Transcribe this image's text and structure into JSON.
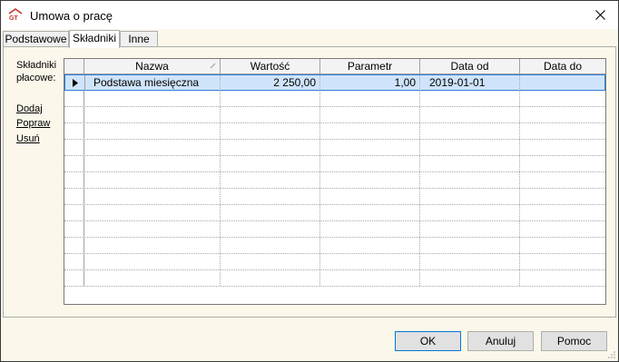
{
  "window": {
    "title": "Umowa o pracę"
  },
  "tabs": [
    {
      "label": "Podstawowe",
      "active": false
    },
    {
      "label": "Składniki",
      "active": true
    },
    {
      "label": "Inne",
      "active": false
    }
  ],
  "sidebar": {
    "label_line1": "Składniki",
    "label_line2": "płacowe:",
    "links": [
      "Dodaj",
      "Popraw",
      "Usuń"
    ]
  },
  "grid": {
    "columns": [
      "Nazwa",
      "Wartość",
      "Parametr",
      "Data od",
      "Data do"
    ],
    "rows": [
      {
        "nazwa": "Podstawa miesięczna",
        "wartosc": "2 250,00",
        "parametr": "1,00",
        "data_od": "2019-01-01",
        "data_do": ""
      }
    ],
    "empty_rows": 12
  },
  "buttons": {
    "ok": "OK",
    "cancel": "Anuluj",
    "help": "Pomoc"
  },
  "colors": {
    "selection": "#cfe4fa",
    "selection_border": "#2f7dd3",
    "panel": "#fbf7ea",
    "button_default_border": "#0078d7"
  }
}
